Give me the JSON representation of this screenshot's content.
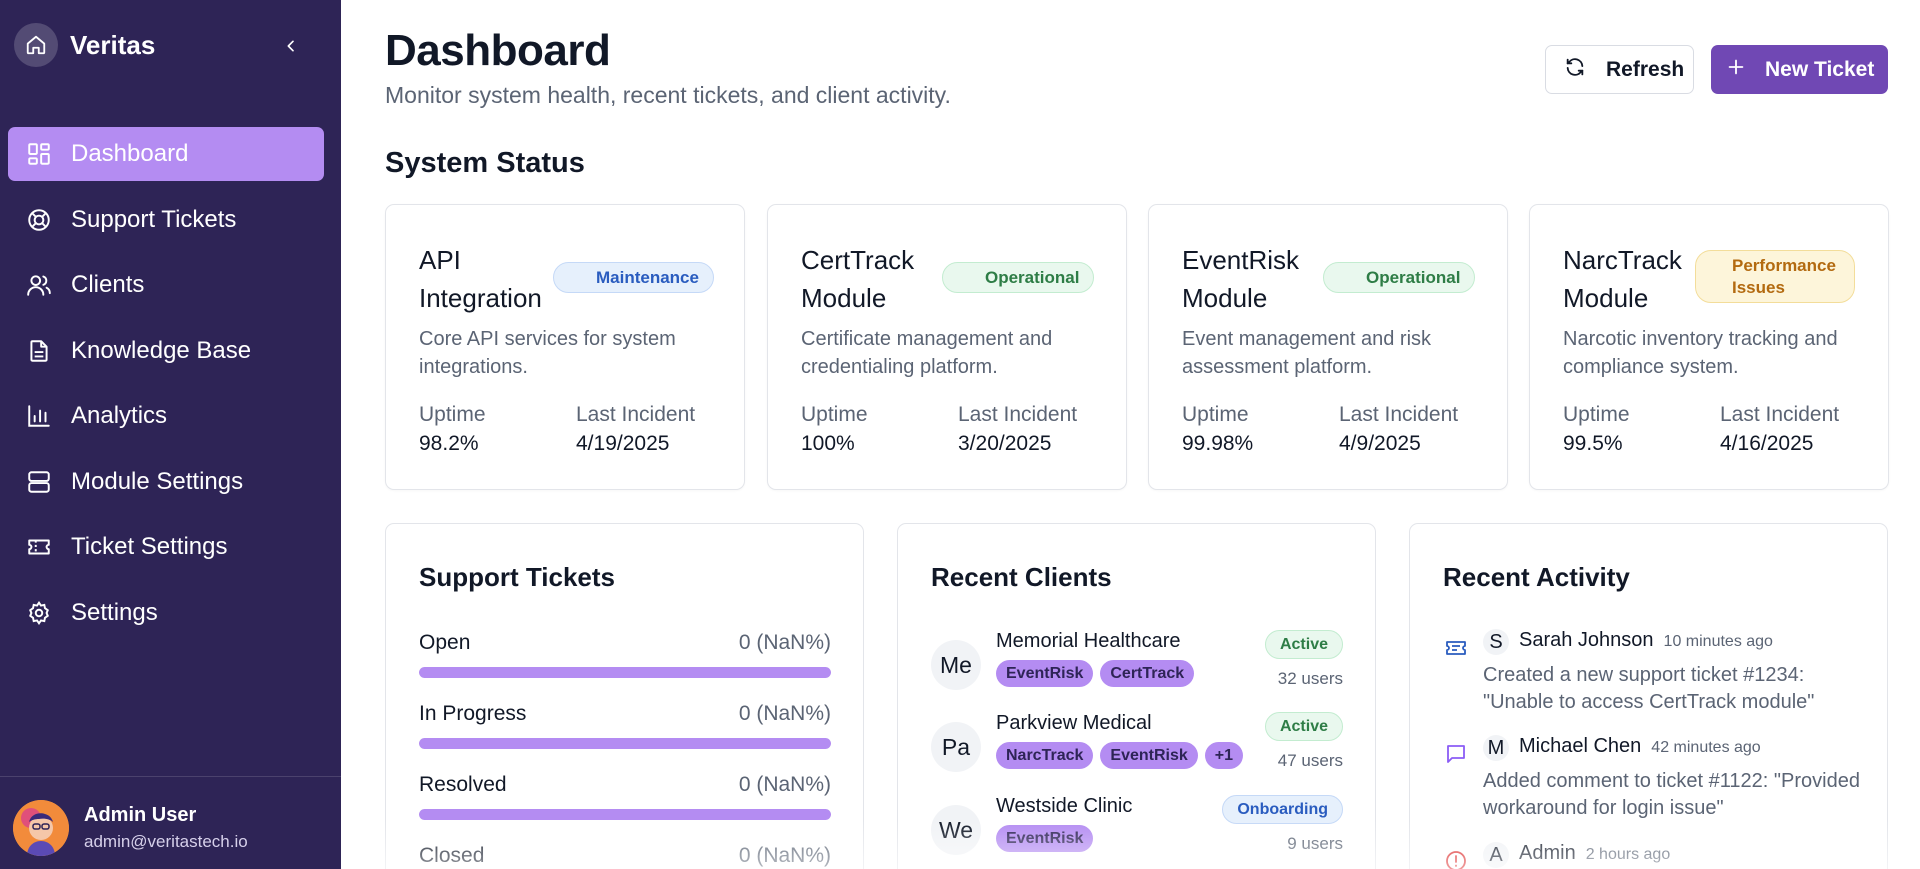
{
  "sidebar": {
    "brand": "Veritas",
    "items": [
      {
        "label": "Dashboard",
        "icon": "layout-grid-icon",
        "active": true
      },
      {
        "label": "Support Tickets",
        "icon": "lifebuoy-icon"
      },
      {
        "label": "Clients",
        "icon": "users-icon"
      },
      {
        "label": "Knowledge Base",
        "icon": "file-text-icon"
      },
      {
        "label": "Analytics",
        "icon": "bar-chart-icon"
      },
      {
        "label": "Module Settings",
        "icon": "server-icon"
      },
      {
        "label": "Ticket Settings",
        "icon": "ticket-icon"
      },
      {
        "label": "Settings",
        "icon": "gear-icon"
      }
    ],
    "user": {
      "name": "Admin User",
      "email": "admin@veritastech.io"
    }
  },
  "header": {
    "title": "Dashboard",
    "subtitle": "Monitor system health, recent tickets, and client activity.",
    "refresh_label": "Refresh",
    "new_ticket_label": "New Ticket"
  },
  "system_status": {
    "title": "System Status",
    "uptime_label": "Uptime",
    "incident_label": "Last Incident",
    "modules": [
      {
        "name": "API Integration",
        "status": "Maintenance",
        "description": "Core API services for system integrations.",
        "uptime": "98.2%",
        "last_incident": "4/19/2025"
      },
      {
        "name": "CertTrack Module",
        "status": "Operational",
        "description": "Certificate management and credentialing platform.",
        "uptime": "100%",
        "last_incident": "3/20/2025"
      },
      {
        "name": "EventRisk Module",
        "status": "Operational",
        "description": "Event management and risk assessment platform.",
        "uptime": "99.98%",
        "last_incident": "4/9/2025"
      },
      {
        "name": "NarcTrack Module",
        "status": "Performance Issues",
        "description": "Narcotic inventory tracking and compliance system.",
        "uptime": "99.5%",
        "last_incident": "4/16/2025"
      }
    ]
  },
  "support_tickets": {
    "title": "Support Tickets",
    "rows": [
      {
        "label": "Open",
        "value": "0 (NaN%)",
        "fill": 1.0
      },
      {
        "label": "In Progress",
        "value": "0 (NaN%)",
        "fill": 1.0
      },
      {
        "label": "Resolved",
        "value": "0 (NaN%)",
        "fill": 1.0
      },
      {
        "label": "Closed",
        "value": "0 (NaN%)",
        "fill": 1.0
      }
    ]
  },
  "recent_clients": {
    "title": "Recent Clients",
    "clients": [
      {
        "initials": "Me",
        "name": "Memorial Healthcare",
        "tags": [
          "EventRisk",
          "CertTrack"
        ],
        "status": "Active",
        "users": "32 users"
      },
      {
        "initials": "Pa",
        "name": "Parkview Medical",
        "tags": [
          "NarcTrack",
          "EventRisk",
          "+1"
        ],
        "status": "Active",
        "users": "47 users"
      },
      {
        "initials": "We",
        "name": "Westside Clinic",
        "tags": [
          "EventRisk"
        ],
        "status": "Onboarding",
        "users": "9 users"
      }
    ]
  },
  "recent_activity": {
    "title": "Recent Activity",
    "items": [
      {
        "icon": "ticket-icon",
        "initial": "S",
        "user": "Sarah Johnson",
        "time": "10 minutes ago",
        "text": "Created a new support ticket #1234: \"Unable to access CertTrack module\""
      },
      {
        "icon": "message-icon",
        "initial": "M",
        "user": "Michael Chen",
        "time": "42 minutes ago",
        "text": "Added comment to ticket #1122: \"Provided workaround for login issue\""
      },
      {
        "icon": "alert-icon",
        "initial": "A",
        "user": "Admin",
        "time": "2 hours ago",
        "text": ""
      }
    ]
  },
  "colors": {
    "sidebar_bg": "#2e2456",
    "accent": "#b48cf2",
    "primary_button": "#7048b4"
  }
}
